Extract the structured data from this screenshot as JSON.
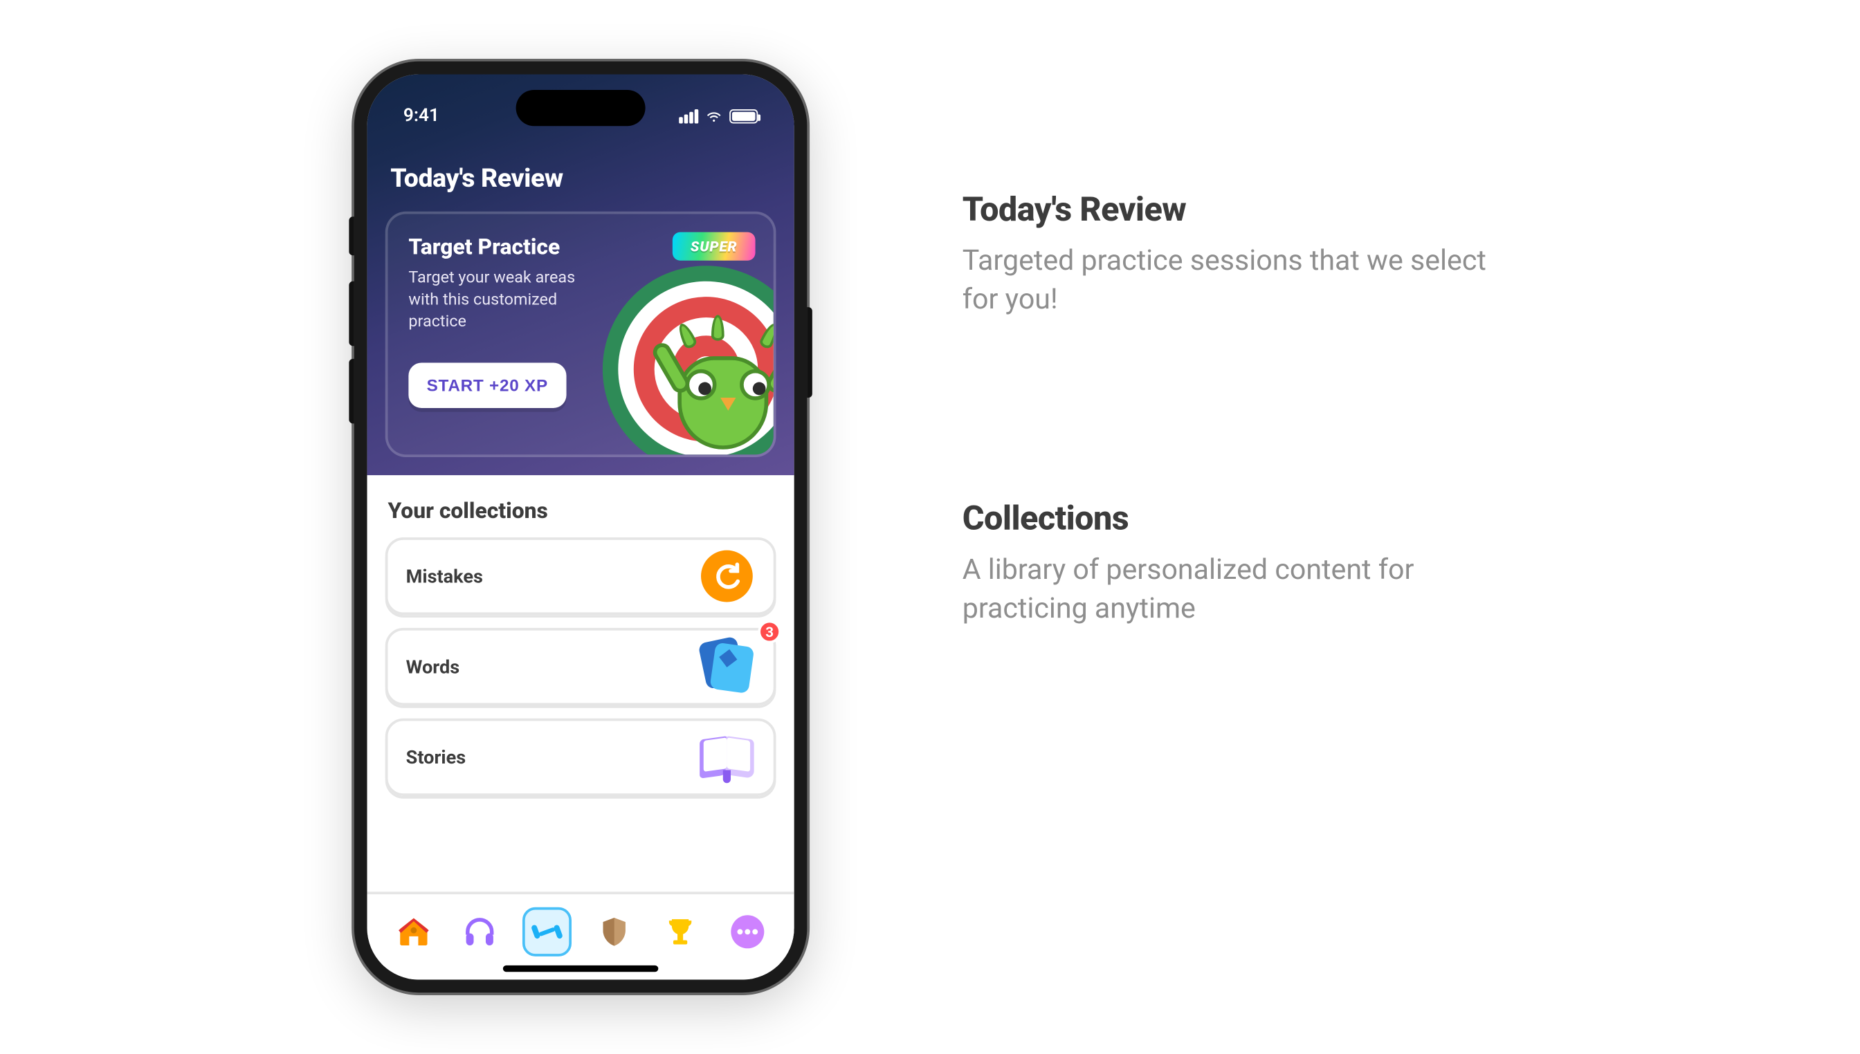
{
  "status": {
    "time": "9:41"
  },
  "header": {
    "title": "Today's Review"
  },
  "card": {
    "title": "Target Practice",
    "description": "Target your weak areas with this customized practice",
    "cta": "START +20 XP",
    "badge": "SUPER"
  },
  "collections": {
    "title": "Your collections",
    "items": [
      {
        "label": "Mistakes",
        "icon": "refresh"
      },
      {
        "label": "Words",
        "icon": "cards",
        "badge": "3"
      },
      {
        "label": "Stories",
        "icon": "book"
      }
    ]
  },
  "tabs": [
    "home",
    "listen",
    "practice",
    "shield",
    "leaderboard",
    "more"
  ],
  "annotations": [
    {
      "title": "Today's Review",
      "desc": "Targeted practice sessions that we select for you!"
    },
    {
      "title": "Collections",
      "desc": "A library of personalized content for practicing anytime"
    }
  ]
}
